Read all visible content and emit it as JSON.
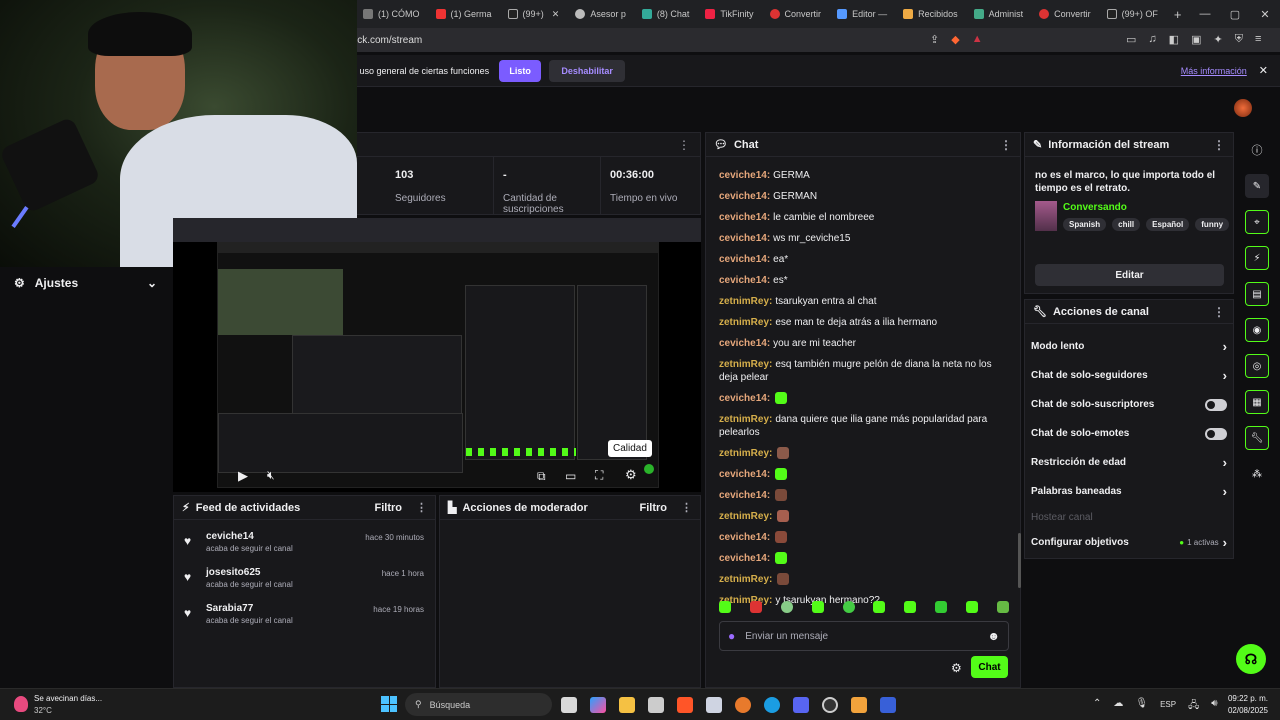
{
  "browser": {
    "tabs": [
      "(1) CÓMO",
      "(1) Germa",
      "(99+)",
      "Asesor p",
      "(8) Chat",
      "TikFinity",
      "Convertir",
      "Editor —",
      "Recibidos",
      "Administ",
      "Convertir",
      "(99+) OF"
    ],
    "new_tab": "+",
    "url": "ick.com/stream",
    "win_min": "—",
    "win_max": "▢",
    "win_close": "✕"
  },
  "cookie": {
    "text": "l uso general de ciertas funciones",
    "accept": "Listo",
    "disable": "Deshabilitar",
    "more": "Más información",
    "close": "✕"
  },
  "stats": {
    "followers_value": "103",
    "followers_label": "Seguidores",
    "subs_value": "-",
    "subs_label": "Cantidad de suscripciones",
    "live_value": "00:36:00",
    "live_label": "Tiempo en vivo"
  },
  "settings": {
    "label": "Ajustes"
  },
  "player": {
    "tooltip": "Calidad"
  },
  "activity": {
    "title": "Feed de actividades",
    "filter": "Filtro",
    "items": [
      {
        "name": "ceviche14",
        "sub": "acaba de seguir el canal",
        "time": "hace 30 minutos"
      },
      {
        "name": "josesito625",
        "sub": "acaba de seguir el canal",
        "time": "hace 1 hora"
      },
      {
        "name": "Sarabia77",
        "sub": "acaba de seguir el canal",
        "time": "hace 19 horas"
      }
    ]
  },
  "moderator": {
    "title": "Acciones de moderador",
    "filter": "Filtro"
  },
  "chat": {
    "title": "Chat",
    "messages": [
      {
        "user": "ceviche14:",
        "text": "GERMA"
      },
      {
        "user": "ceviche14:",
        "text": "GERMAN"
      },
      {
        "user": "ceviche14:",
        "text": "le cambie el nombreee"
      },
      {
        "user": "ceviche14:",
        "text": "ws mr_ceviche15"
      },
      {
        "user": "ceviche14:",
        "text": "ea*"
      },
      {
        "user": "ceviche14:",
        "text": "es*"
      },
      {
        "user": "zetnimRey:",
        "text": "tsarukyan entra al chat"
      },
      {
        "user": "zetnimRey:",
        "text": "ese man te deja atrás a ilia hermano"
      },
      {
        "user": "ceviche14:",
        "text": "you are mi teacher"
      },
      {
        "user": "zetnimRey:",
        "text": "esq también mugre pelón de diana la neta no los deja pelear"
      },
      {
        "user": "ceviche14:",
        "text": ""
      },
      {
        "user": "zetnimRey:",
        "text": "dana quiere que ilia gane más popularidad para pelearlos"
      },
      {
        "user": "zetnimRey:",
        "text": ""
      },
      {
        "user": "ceviche14:",
        "text": ""
      },
      {
        "user": "ceviche14:",
        "text": ""
      },
      {
        "user": "zetnimRey:",
        "text": ""
      },
      {
        "user": "ceviche14:",
        "text": ""
      },
      {
        "user": "ceviche14:",
        "text": ""
      },
      {
        "user": "zetnimRey:",
        "text": ""
      },
      {
        "user": "zetnimRey:",
        "text": "y tsarukyan hermano??"
      }
    ],
    "placeholder": "Enviar un mensaje",
    "send": "Chat"
  },
  "info": {
    "title": "Información del stream",
    "description": "no es el marco, lo que importa todo el tiempo es el retrato.",
    "category": "Conversando",
    "tags": [
      "Spanish",
      "chill",
      "Español",
      "funny"
    ],
    "edit": "Editar"
  },
  "actions": {
    "title": "Acciones de canal",
    "items": [
      {
        "label": "Modo lento",
        "control": "chevron"
      },
      {
        "label": "Chat de solo-seguidores",
        "control": "chevron"
      },
      {
        "label": "Chat de solo-suscriptores",
        "control": "toggle"
      },
      {
        "label": "Chat de solo-emotes",
        "control": "toggle"
      },
      {
        "label": "Restricción de edad",
        "control": "chevron"
      },
      {
        "label": "Palabras baneadas",
        "control": "chevron"
      }
    ],
    "host": "Hostear canal",
    "goals": "Configurar objetivos",
    "goals_active": "1 activas"
  },
  "taskbar": {
    "weather_text": "Se avecinan días...",
    "weather_temp": "32°C",
    "search": "Búsqueda",
    "lang": "ESP",
    "time": "09:22 p. m.",
    "date": "02/08/2025"
  },
  "colors": {
    "accent": "#53fc18",
    "purple": "#7b5cff",
    "panel": "#18181b"
  }
}
